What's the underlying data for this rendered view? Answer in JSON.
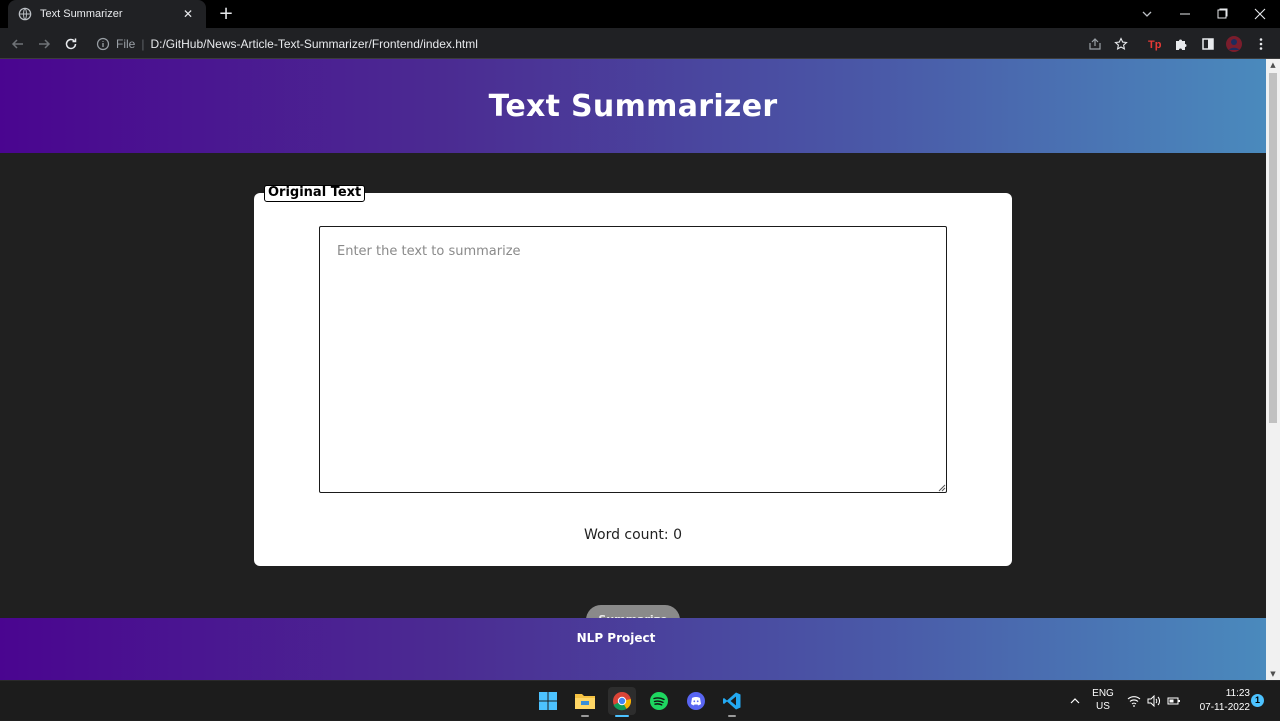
{
  "browser": {
    "tab_title": "Text Summarizer",
    "address": {
      "scheme_label": "File",
      "url": "D:/GitHub/News-Article-Text-Summarizer/Frontend/index.html"
    }
  },
  "page": {
    "header_title": "Text Summarizer",
    "legend": "Original Text",
    "textarea_placeholder": "Enter the text to summarize",
    "textarea_value": "",
    "word_count": "Word count: 0",
    "summarize_label": "Summarize",
    "footer": "NLP Project"
  },
  "taskbar": {
    "apps": [
      "start-icon",
      "file-explorer-icon",
      "chrome-icon",
      "spotify-icon",
      "discord-icon",
      "vscode-icon"
    ],
    "lang_line1": "ENG",
    "lang_line2": "US",
    "time": "11:23",
    "date": "07-11-2022",
    "notifications": "1"
  },
  "colors": {
    "header_gradient_start": "#4a0590",
    "header_gradient_end": "#4a8abd",
    "page_background": "#202020",
    "card_background": "#ffffff"
  }
}
